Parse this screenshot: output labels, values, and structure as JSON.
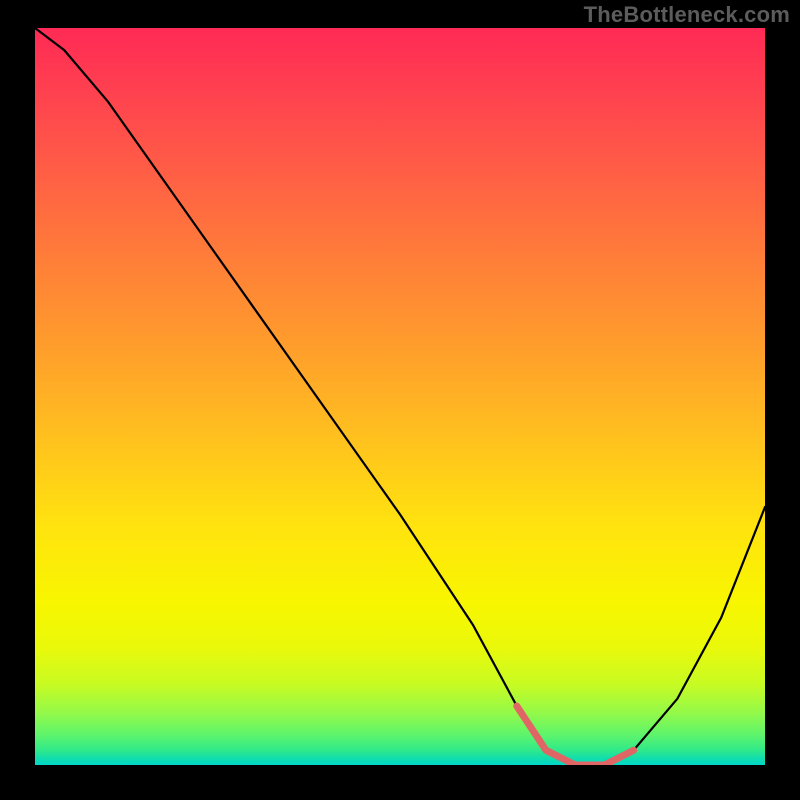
{
  "watermark": "TheBottleneck.com",
  "chart_data": {
    "type": "line",
    "title": "",
    "xlabel": "",
    "ylabel": "",
    "xlim": [
      0,
      100
    ],
    "ylim": [
      0,
      100
    ],
    "grid": false,
    "series": [
      {
        "name": "bottleneck-curve",
        "x": [
          0,
          4,
          10,
          20,
          30,
          40,
          50,
          60,
          66,
          70,
          74,
          78,
          82,
          88,
          94,
          100
        ],
        "values": [
          100,
          97,
          90,
          76,
          62,
          48,
          34,
          19,
          8,
          2,
          0,
          0,
          2,
          9,
          20,
          35
        ]
      }
    ],
    "highlight": {
      "name": "optimal-range",
      "x": [
        66,
        68,
        70,
        72,
        74,
        76,
        78,
        80,
        82
      ],
      "values": [
        8,
        5,
        2,
        1,
        0,
        0,
        0,
        1,
        2
      ],
      "color": "#e06666"
    },
    "gradient_stops": [
      {
        "pos": 0,
        "color": "#ff2a55"
      },
      {
        "pos": 8,
        "color": "#ff3f50"
      },
      {
        "pos": 18,
        "color": "#ff5a47"
      },
      {
        "pos": 30,
        "color": "#ff7a3a"
      },
      {
        "pos": 42,
        "color": "#ff9a2d"
      },
      {
        "pos": 55,
        "color": "#ffbf1f"
      },
      {
        "pos": 68,
        "color": "#ffe40e"
      },
      {
        "pos": 78,
        "color": "#f8f600"
      },
      {
        "pos": 84,
        "color": "#eaf90a"
      },
      {
        "pos": 89,
        "color": "#c8fb22"
      },
      {
        "pos": 93,
        "color": "#92f94a"
      },
      {
        "pos": 96,
        "color": "#5cf46d"
      },
      {
        "pos": 98,
        "color": "#2fe98a"
      },
      {
        "pos": 99,
        "color": "#13deaa"
      },
      {
        "pos": 100,
        "color": "#00d7c8"
      }
    ]
  }
}
